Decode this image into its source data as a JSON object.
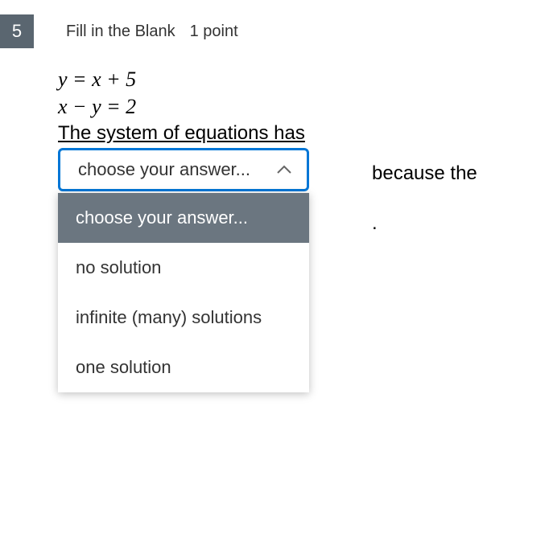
{
  "header": {
    "number": "5",
    "type": "Fill in the Blank",
    "points": "1 point"
  },
  "content": {
    "equation1": "y = x + 5",
    "equation2": "x − y = 2",
    "question_text": "The system of equations has",
    "trailing": "because the",
    "dot": "."
  },
  "dropdown": {
    "selected": "choose your answer...",
    "options": [
      {
        "label": "choose your answer...",
        "highlighted": true
      },
      {
        "label": "no solution",
        "highlighted": false
      },
      {
        "label": "infinite (many) solutions",
        "highlighted": false
      },
      {
        "label": "one solution",
        "highlighted": false
      }
    ]
  }
}
